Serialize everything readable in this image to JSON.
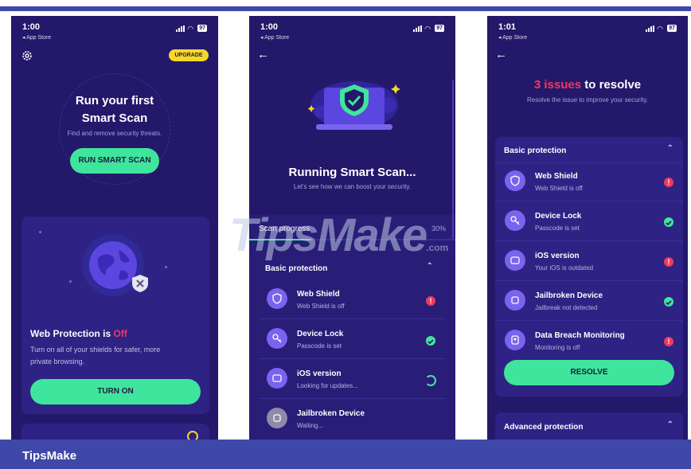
{
  "status_bar": [
    {
      "time": "1:00",
      "back": "◂ App Store",
      "battery": "97"
    },
    {
      "time": "1:00",
      "back": "◂ App Store",
      "battery": "97"
    },
    {
      "time": "1:01",
      "back": "◂ App Store",
      "battery": "97"
    }
  ],
  "screen1": {
    "upgrade_label": "UPGRADE",
    "title_line1": "Run your first",
    "title_line2": "Smart Scan",
    "subtitle": "Find and remove security threats.",
    "scan_button": "RUN SMART SCAN",
    "web_protection_label": "Web Protection is ",
    "web_protection_state": "Off",
    "web_protection_desc_line1": "Turn on all of your shields for safer, more",
    "web_protection_desc_line2": "private browsing.",
    "turn_on_button": "TURN ON"
  },
  "screen2": {
    "title": "Running Smart Scan...",
    "subtitle": "Let's see how we can boost your security.",
    "scan_progress_label": "Scan progress",
    "scan_progress_value": "30%",
    "progress": 0.3,
    "section_title": "Basic protection",
    "items": [
      {
        "title": "Web Shield",
        "sub": "Web Shield is off",
        "status": "issue"
      },
      {
        "title": "Device Lock",
        "sub": "Passcode is set",
        "status": "ok"
      },
      {
        "title": "iOS version",
        "sub": "Looking for updates...",
        "status": "loading"
      },
      {
        "title": "Jailbroken Device",
        "sub": "Waiting...",
        "status": "waiting"
      }
    ]
  },
  "screen3": {
    "issues_count": "3 issues",
    "issues_suffix": " to resolve",
    "subtitle": "Resolve the issue to improve your security.",
    "section_title": "Basic protection",
    "items": [
      {
        "title": "Web Shield",
        "sub": "Web Shield is off",
        "status": "issue"
      },
      {
        "title": "Device Lock",
        "sub": "Passcode is set",
        "status": "ok"
      },
      {
        "title": "iOS version",
        "sub": "Your iOS is outdated",
        "status": "issue"
      },
      {
        "title": "Jailbroken Device",
        "sub": "Jailbreak not detected",
        "status": "ok"
      },
      {
        "title": "Data Breach Monitoring",
        "sub": "Monitoring is off",
        "status": "issue"
      }
    ],
    "resolve_button": "RESOLVE",
    "advanced_title": "Advanced protection"
  },
  "watermark": {
    "main": "TipsMake",
    "suffix": ".com"
  },
  "footer": {
    "brand": "TipsMake"
  },
  "colors": {
    "background": "#24186a",
    "card": "#2e2284",
    "accent_green": "#3fe59c",
    "issue_red": "#f0395f",
    "accent_purple": "#7a63ee",
    "upgrade_yellow": "#f5d72a",
    "footer_blue": "#3f48a8"
  }
}
